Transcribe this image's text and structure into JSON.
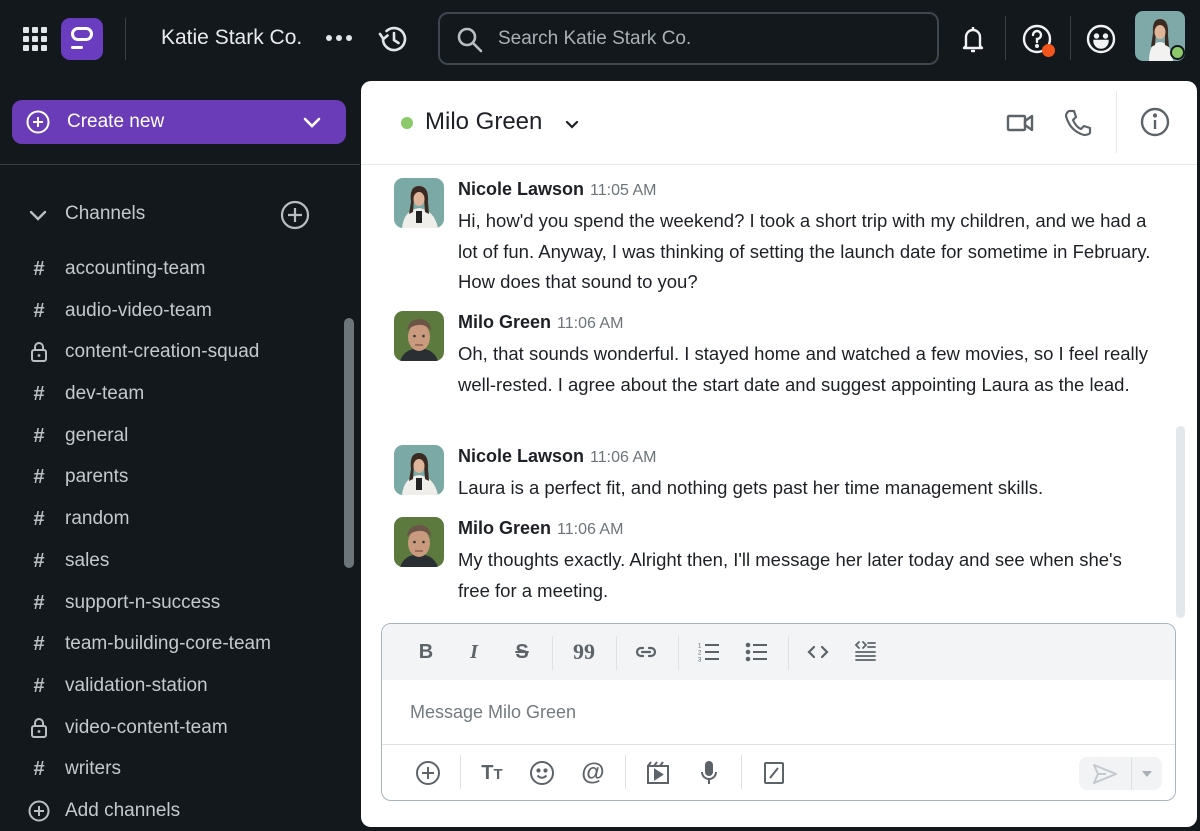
{
  "topbar": {
    "workspace_name": "Katie Stark Co.",
    "search_placeholder": "Search Katie Stark Co.",
    "icons": [
      "apps-grid-icon",
      "logo",
      "more-icon",
      "history-icon",
      "search-icon",
      "bell-icon",
      "help-icon",
      "emoji-icon",
      "user-avatar"
    ],
    "help_badge_color": "#f2541b",
    "user_status_color": "#8bc96b"
  },
  "sidebar": {
    "create_new_label": "Create new",
    "accent_color": "#6a3cb8",
    "channels_header": "Channels",
    "channels": [
      {
        "name": "accounting-team",
        "type": "public"
      },
      {
        "name": "audio-video-team",
        "type": "public"
      },
      {
        "name": "content-creation-squad",
        "type": "private"
      },
      {
        "name": "dev-team",
        "type": "public"
      },
      {
        "name": "general",
        "type": "public"
      },
      {
        "name": "parents",
        "type": "public"
      },
      {
        "name": "random",
        "type": "public"
      },
      {
        "name": "sales",
        "type": "public"
      },
      {
        "name": "support-n-success",
        "type": "public"
      },
      {
        "name": "team-building-core-team",
        "type": "public"
      },
      {
        "name": "validation-station",
        "type": "public"
      },
      {
        "name": "video-content-team",
        "type": "private"
      },
      {
        "name": "writers",
        "type": "public"
      }
    ],
    "add_channels_label": "Add channels"
  },
  "chat": {
    "title": "Milo Green",
    "presence_color": "#8bc96b",
    "messages": [
      {
        "author": "Nicole Lawson",
        "time": "11:05 AM",
        "text": "Hi, how'd you spend the weekend? I took a short trip with my children, and we had a lot of fun. Anyway, I was thinking of setting the launch date for sometime in February. How does that sound to you?"
      },
      {
        "author": "Milo Green",
        "time": "11:06 AM",
        "text": "Oh, that sounds wonderful. I stayed home and watched a few movies, so I feel really well-rested. I agree about the start date and suggest appointing Laura as the lead."
      },
      {
        "author": "Nicole Lawson",
        "time": "11:06 AM",
        "text": "Laura is a perfect fit, and nothing gets past her time management skills."
      },
      {
        "author": "Milo Green",
        "time": "11:06 AM",
        "text": "My thoughts exactly. Alright then, I'll message her later today and see when she's free for a meeting."
      }
    ],
    "composer": {
      "placeholder": "Message Milo Green",
      "value": ""
    }
  }
}
